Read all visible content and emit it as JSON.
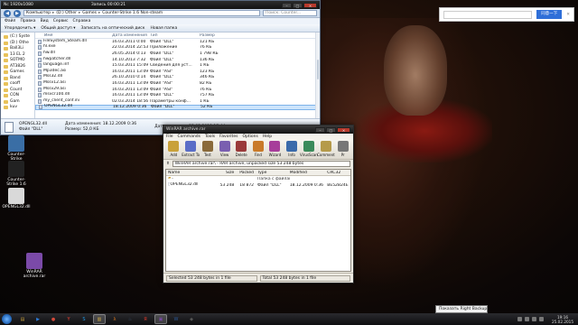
{
  "explorer": {
    "title": "Nc 1920x1080",
    "title_right": "Запись 00:00:21",
    "address": [
      "Компьютер",
      "(D:) Other",
      "Games",
      "Counter-Strike 1.6 Non-steam"
    ],
    "search_placeholder": "Поиск: Counter...",
    "menu": [
      "Файл",
      "Правка",
      "Вид",
      "Сервис",
      "Справка"
    ],
    "toolbar": [
      "Упорядочить ▾",
      "Общий доступ ▾",
      "Записать на оптический диск",
      "Новая папка"
    ],
    "nav_items": [
      "(C:) Syste",
      "(D:) Othe",
      "Ball3Li",
      "13 EL 2",
      "SOTMO",
      "AT3826",
      "Games",
      "Band",
      "cooff",
      "Count",
      "CON",
      "Gam",
      "kuv"
    ],
    "columns": [
      "Имя",
      "Дата изменения",
      "Тип",
      "Размер"
    ],
    "files": [
      {
        "name": "FileSystem_Steam.dll",
        "date": "16.03.2011 0:00",
        "type": "Файл \"DLL\"",
        "size": "121 КБ"
      },
      {
        "name": "hl.exe",
        "date": "22.03.2014 22:53",
        "type": "Приложение",
        "size": "76 КБ"
      },
      {
        "name": "hw.dll",
        "date": "26.05.2014 0:13",
        "type": "Файл \"DLL\"",
        "size": "1 798 КБ"
      },
      {
        "name": "hwpatcher.dll",
        "date": "14.10.2013 7:32",
        "type": "Файл \"DLL\"",
        "size": "136 КБ"
      },
      {
        "name": "language.inf",
        "date": "15.03.2011 15:09",
        "type": "Сведения для уст...",
        "size": "1 КБ"
      },
      {
        "name": "Mp3dec.asi",
        "date": "16.03.2011 13:09",
        "type": "Файл \"ASI\"",
        "size": "123 КБ"
      },
      {
        "name": "Mss32.dll",
        "date": "26.10.2010 0:14",
        "type": "Файл \"DLL\"",
        "size": "346 КБ"
      },
      {
        "name": "Mssv12.asi",
        "date": "16.03.2011 13:09",
        "type": "Файл \"ASI\"",
        "size": "82 КБ"
      },
      {
        "name": "Mssv29.asi",
        "date": "16.03.2011 13:09",
        "type": "Файл \"ASI\"",
        "size": "76 КБ"
      },
      {
        "name": "msvcr100.dll",
        "date": "16.03.2011 13:09",
        "type": "Файл \"DLL\"",
        "size": "757 КБ"
      },
      {
        "name": "my_client_conf.ini",
        "date": "02.03.2014 18:56",
        "type": "Параметры конф...",
        "size": "1 КБ"
      },
      {
        "name": "OPENGL32.dll",
        "date": "18.12.2009 0:36",
        "type": "Файл \"DLL\"",
        "size": "52 КБ"
      }
    ],
    "selected_index": 11,
    "details": {
      "name": "OPENGL32.dll",
      "modified_label": "Дата изменения: 18.12.2009 0:36",
      "created_label": "Дата создания: 25.02.2015 17:44",
      "type": "Файл \"DLL\"",
      "size_label": "Размер: 52,0 КБ"
    }
  },
  "winrar": {
    "title": "WinRAR archive.rar",
    "menu": [
      "File",
      "Commands",
      "Tools",
      "Favorites",
      "Options",
      "Help"
    ],
    "tools": [
      {
        "label": "Add",
        "color": "#c9a13a"
      },
      {
        "label": "Extract To",
        "color": "#5b6ec7"
      },
      {
        "label": "Test",
        "color": "#8a6a3a"
      },
      {
        "label": "View",
        "color": "#7a5fb0"
      },
      {
        "label": "Delete",
        "color": "#9a3a3a"
      },
      {
        "label": "Find",
        "color": "#c97a2a"
      },
      {
        "label": "Wizard",
        "color": "#a73d9a"
      },
      {
        "label": "Info",
        "color": "#3a6aaa"
      },
      {
        "label": "VirusScan",
        "color": "#3a8a5a"
      },
      {
        "label": "Comment",
        "color": "#b59a4a"
      },
      {
        "label": "Pr",
        "color": "#777777"
      }
    ],
    "path": "WinRAR archive.rar\\ - RAR archive, unpacked size 53 248 bytes",
    "columns": [
      "Name",
      "Size",
      "Packed",
      "Type",
      "Modified",
      "CRC32"
    ],
    "rows": [
      {
        "name": "..",
        "size": "",
        "packed": "",
        "type": "Папка с файлами",
        "modified": "",
        "crc": ""
      },
      {
        "name": "OPENGL32.dll",
        "size": "53 248",
        "packed": "18 872",
        "type": "Файл \"DLL\"",
        "modified": "18.12.2009 0:36",
        "crc": "BE52B24E"
      }
    ],
    "status": "Selected 53 248 bytes in 1 file",
    "status_right": "Total 53 248 bytes in 1 file"
  },
  "desktop": {
    "icons": [
      {
        "label": "Counter-Strike",
        "color": "#3a6ea5"
      },
      {
        "label": "Counter-Strike 1.6",
        "color": "#222222"
      },
      {
        "label": "OPENGL32.dll",
        "color": "#d9d9d9"
      },
      {
        "label": "WinRAR archive.rar",
        "color": "#7b4aa8"
      }
    ]
  },
  "popup": {
    "button": "同意一下"
  },
  "tray_tip": "Показать Right Backup",
  "taskbar": {
    "apps": [
      {
        "name": "explorer",
        "glyph": "▤",
        "color": "#c9a13a"
      },
      {
        "name": "media",
        "glyph": "▶",
        "color": "#2e7bd6"
      },
      {
        "name": "chrome",
        "glyph": "●",
        "color": "#d44a3a"
      },
      {
        "name": "yandex",
        "glyph": "Y",
        "color": "#ff4433"
      },
      {
        "name": "skype",
        "glyph": "S",
        "color": "#1e9be8"
      },
      {
        "name": "folder",
        "glyph": "▥",
        "color": "#e0b84a"
      },
      {
        "name": "half-life",
        "glyph": "λ",
        "color": "#e27b1c"
      },
      {
        "name": "steam",
        "glyph": "♨",
        "color": "#3b4b63"
      },
      {
        "name": "yandex-browser",
        "glyph": "Я",
        "color": "#e23b2a"
      },
      {
        "name": "winrar",
        "glyph": "▣",
        "color": "#7b4aa8"
      },
      {
        "name": "word",
        "glyph": "W",
        "color": "#2b5797"
      },
      {
        "name": "app",
        "glyph": "◆",
        "color": "#555555"
      }
    ],
    "time": "19:16",
    "date": "25.02.2015"
  }
}
